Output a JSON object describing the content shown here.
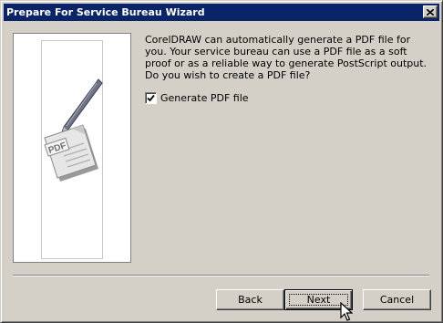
{
  "window": {
    "title": "Prepare For Service Bureau Wizard",
    "close_glyph": "✕"
  },
  "message": "CorelDRAW can automatically generate a PDF file for you. Your service bureau can use a PDF file as a soft proof or as a reliable way to generate PostScript output. Do you wish to create a PDF file?",
  "options": {
    "generate_pdf": {
      "label": "Generate PDF file",
      "checked": true
    }
  },
  "illustration": {
    "icon": "pdf-document-with-pen-icon",
    "badge_text": "PDF"
  },
  "buttons": {
    "back": "Back",
    "next": "Next",
    "cancel": "Cancel",
    "default": "next"
  },
  "colors": {
    "title_bar": "#0a246a",
    "dialog_face": "#d4d0c8"
  }
}
